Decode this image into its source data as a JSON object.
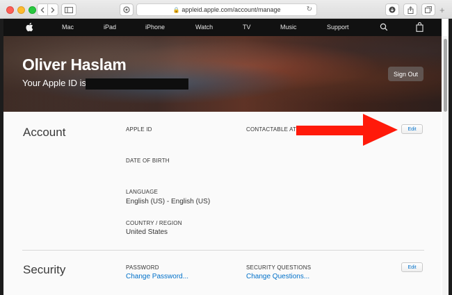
{
  "browser": {
    "url": "appleid.apple.com/account/manage",
    "icons": {
      "back": "chevron-left-icon",
      "forward": "chevron-right-icon",
      "sidebar": "sidebar-icon",
      "shield": "shield-icon",
      "lock": "lock-icon",
      "reload": "reload-icon",
      "download": "download-icon",
      "share": "share-icon",
      "tabs": "tabs-icon",
      "new_tab": "plus-icon"
    }
  },
  "nav": {
    "items": [
      "Mac",
      "iPad",
      "iPhone",
      "Watch",
      "TV",
      "Music",
      "Support"
    ],
    "icons": {
      "logo": "apple-logo-icon",
      "search": "search-icon",
      "bag": "bag-icon"
    }
  },
  "hero": {
    "name": "Oliver Haslam",
    "apple_id_prefix": "Your Apple ID is",
    "signout_label": "Sign Out"
  },
  "account": {
    "title": "Account",
    "apple_id_label": "APPLE ID",
    "contactable_label": "CONTACTABLE AT",
    "dob_label": "DATE OF BIRTH",
    "language_label": "LANGUAGE",
    "language_value": "English (US) - English (US)",
    "country_label": "COUNTRY / REGION",
    "country_value": "United States",
    "edit_label": "Edit"
  },
  "security": {
    "title": "Security",
    "password_label": "PASSWORD",
    "password_link": "Change Password...",
    "questions_label": "SECURITY QUESTIONS",
    "questions_link": "Change Questions...",
    "edit_label": "Edit"
  },
  "colors": {
    "accent_link": "#0070c9",
    "annotation_arrow": "#ff1a0a",
    "nav_bg": "#111111"
  }
}
